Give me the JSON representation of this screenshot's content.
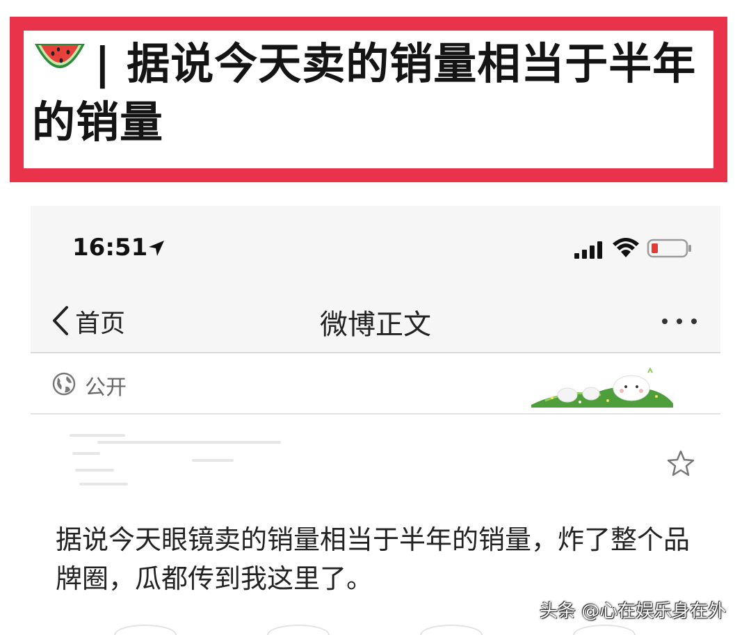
{
  "banner": {
    "icon": "watermelon-icon",
    "separator": "|",
    "title": "据说今天卖的销量相当于半年的销量",
    "frame_color": "#e8334a"
  },
  "status_bar": {
    "time": "16:51",
    "battery_color": "#e53935"
  },
  "nav": {
    "back_label": "首页",
    "title": "微博正文"
  },
  "visibility": {
    "label": "公开"
  },
  "post": {
    "text": "据说今天眼镜卖的销量相当于半年的销量，炸了整个品牌圈，瓜都传到我这里了。"
  },
  "watermark": {
    "text": "头条 @心在娱乐身在外"
  }
}
